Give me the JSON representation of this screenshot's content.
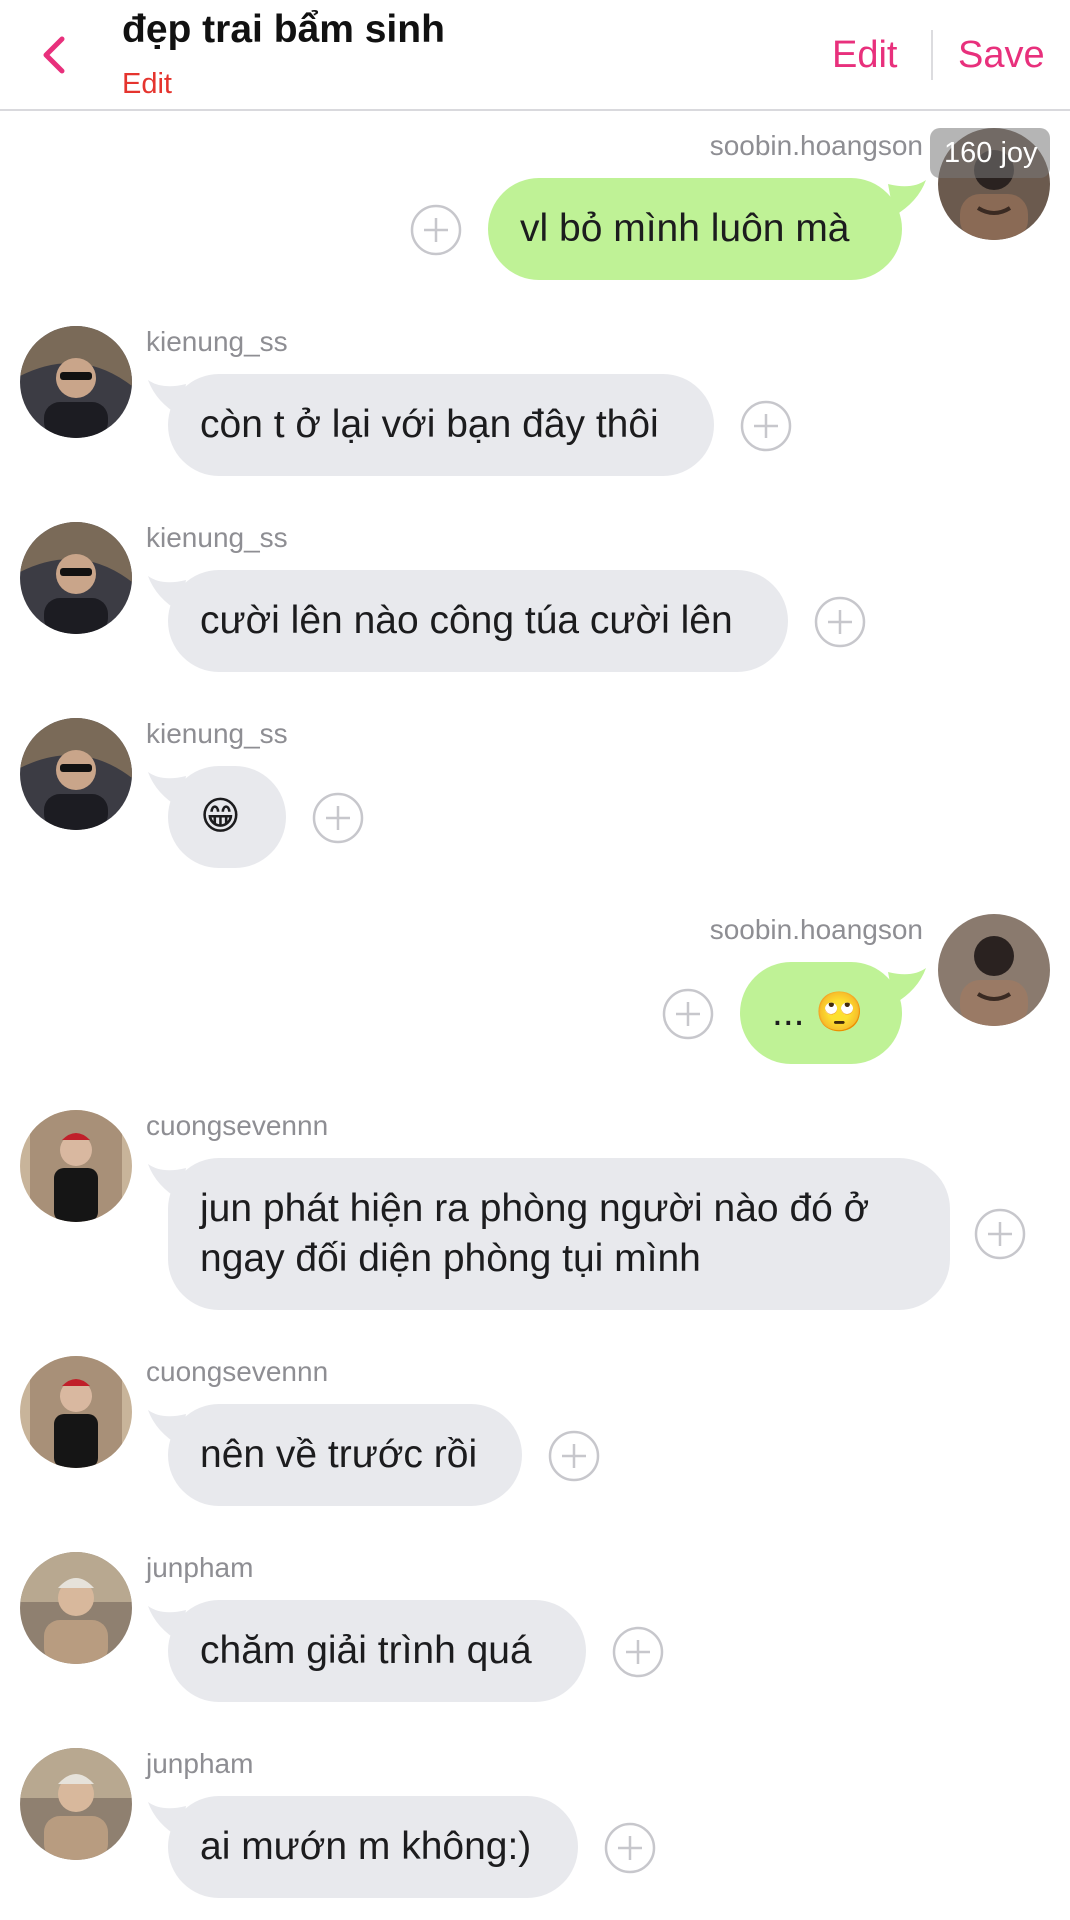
{
  "header": {
    "title": "đẹp trai bẩm sinh",
    "subtitle": "Edit",
    "edit_label": "Edit",
    "save_label": "Save"
  },
  "badge": {
    "text": "160 joy"
  },
  "messages": [
    {
      "user": "soobin.hoangson",
      "text": "vl bỏ mình luôn mà",
      "direction": "out"
    },
    {
      "user": "kienung_ss",
      "text": "còn t ở lại với bạn đây thôi",
      "direction": "in"
    },
    {
      "user": "kienung_ss",
      "text": "cười lên nào công túa cười lên",
      "direction": "in"
    },
    {
      "user": "kienung_ss",
      "text": "😁",
      "direction": "in"
    },
    {
      "user": "soobin.hoangson",
      "text": "... 🙄",
      "direction": "out"
    },
    {
      "user": "cuongsevennn",
      "text": "jun phát hiện ra phòng người nào đó ở ngay đối diện phòng tụi mình",
      "direction": "in"
    },
    {
      "user": "cuongsevennn",
      "text": "nên về trước rồi",
      "direction": "in"
    },
    {
      "user": "junpham",
      "text": "chăm giải trình quá",
      "direction": "in"
    },
    {
      "user": "junpham",
      "text": "ai mướn m không:)",
      "direction": "in"
    }
  ],
  "colors": {
    "accent": "#e8307c",
    "subtitle": "#e5342e",
    "incoming_bubble": "#e8e9ed",
    "outgoing_bubble": "#bff296"
  },
  "icons": {
    "back": "chevron-left-icon",
    "react": "plus-circle-icon"
  }
}
